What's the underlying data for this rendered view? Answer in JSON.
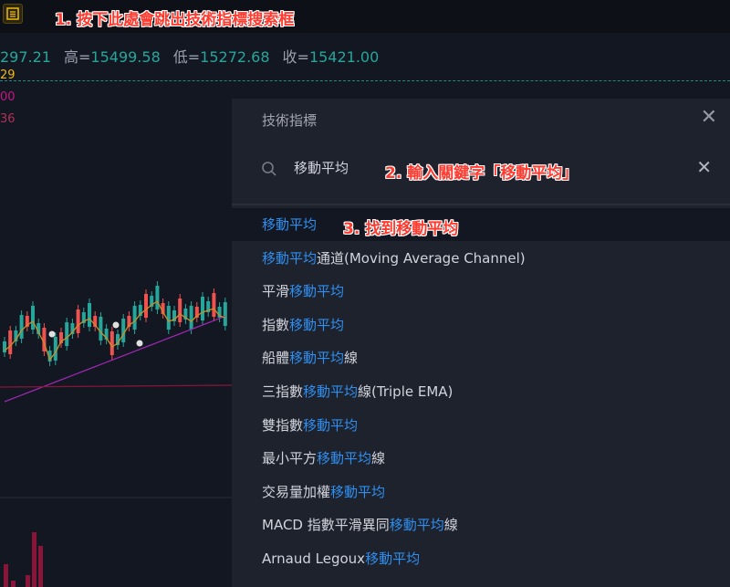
{
  "toolbar": {
    "indicators_icon": "indicators-icon"
  },
  "annotations": {
    "step1": "1. 按下此處會跳出技術指標搜索框",
    "step2": "2. 輸入關鍵字「移動平均」",
    "step3": "3. 找到移動平均"
  },
  "ohlc": {
    "open_partial": "297.21",
    "high_label": "高",
    "high": "15499.58",
    "low_label": "低",
    "low": "15272.68",
    "close_label": "收",
    "close": "15421.00",
    "eq": "="
  },
  "legend_values": [
    "29",
    "00",
    "36"
  ],
  "dialog": {
    "title": "技術指標",
    "search_value": "移動平均",
    "close_icon": "close-icon",
    "clear_icon": "clear-icon"
  },
  "results": [
    {
      "parts": [
        {
          "text": "移動平均",
          "hl": true
        }
      ]
    },
    {
      "parts": [
        {
          "text": "移動平均",
          "hl": true
        },
        {
          "text": "通道(Moving Average Channel)",
          "hl": false
        }
      ]
    },
    {
      "parts": [
        {
          "text": "平滑",
          "hl": false
        },
        {
          "text": "移動平均",
          "hl": true
        }
      ]
    },
    {
      "parts": [
        {
          "text": "指數",
          "hl": false
        },
        {
          "text": "移動平均",
          "hl": true
        }
      ]
    },
    {
      "parts": [
        {
          "text": "船體",
          "hl": false
        },
        {
          "text": "移動平均",
          "hl": true
        },
        {
          "text": "線",
          "hl": false
        }
      ]
    },
    {
      "parts": [
        {
          "text": "三指數",
          "hl": false
        },
        {
          "text": "移動平均",
          "hl": true
        },
        {
          "text": "線(Triple EMA)",
          "hl": false
        }
      ]
    },
    {
      "parts": [
        {
          "text": "雙指數",
          "hl": false
        },
        {
          "text": "移動平均",
          "hl": true
        }
      ]
    },
    {
      "parts": [
        {
          "text": "最小平方",
          "hl": false
        },
        {
          "text": "移動平均",
          "hl": true
        },
        {
          "text": "線",
          "hl": false
        }
      ]
    },
    {
      "parts": [
        {
          "text": "交易量加權",
          "hl": false
        },
        {
          "text": "移動平均",
          "hl": true
        }
      ]
    },
    {
      "parts": [
        {
          "text": "MACD 指數平滑異同",
          "hl": false
        },
        {
          "text": "移動平均",
          "hl": true
        },
        {
          "text": "線",
          "hl": false
        }
      ]
    },
    {
      "parts": [
        {
          "text": "Arnaud Legoux",
          "hl": false
        },
        {
          "text": "移動平均",
          "hl": true
        }
      ]
    }
  ],
  "colors": {
    "up": "#26a69a",
    "down": "#ef5350",
    "highlight": "#2f8ff0",
    "annotation": "#ff3b30"
  }
}
